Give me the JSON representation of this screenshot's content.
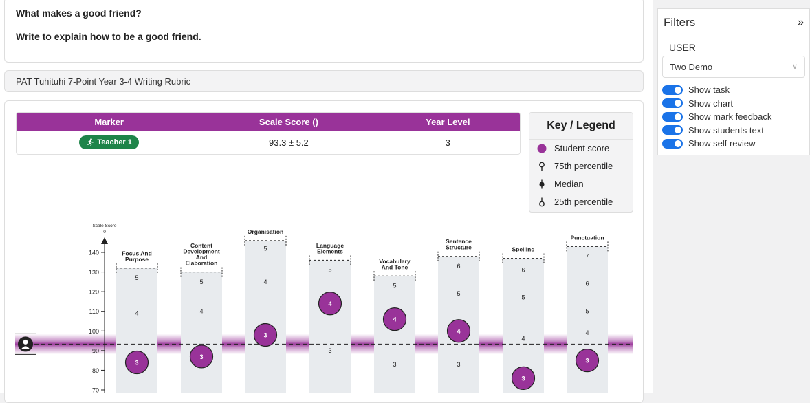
{
  "task": {
    "question": "What makes a good friend?",
    "prompt": "Write to explain how to be a good friend."
  },
  "rubric": {
    "title": "PAT Tuhituhi 7-Point Year 3-4 Writing Rubric"
  },
  "marker_table": {
    "headers": [
      "Marker",
      "Scale Score ()",
      "Year Level"
    ],
    "row": {
      "marker": "Teacher 1",
      "scale_score": "93.3 ± 5.2",
      "year_level": "3"
    }
  },
  "legend": {
    "title": "Key / Legend",
    "items": [
      "Student score",
      "75th percentile",
      "Median",
      "25th percentile"
    ]
  },
  "sidebar": {
    "title": "Filters",
    "user_label": "USER",
    "user_value": "Two Demo",
    "toggles": [
      {
        "label": "Show task",
        "on": true
      },
      {
        "label": "Show chart",
        "on": true
      },
      {
        "label": "Show mark feedback",
        "on": true
      },
      {
        "label": "Show students text",
        "on": true
      },
      {
        "label": "Show self review",
        "on": true
      }
    ]
  },
  "chart_data": {
    "type": "scatter",
    "ylabel": "Scale Score",
    "ylabel_value": "0",
    "yticks": [
      70,
      80,
      90,
      100,
      110,
      120,
      130,
      140
    ],
    "ylim": [
      67,
      152
    ],
    "student_band": 93.3,
    "student_band_error": 5.2,
    "student_score_color": "#993399",
    "categories": [
      {
        "name": "Focus And Purpose",
        "lines": [
          "Focus And",
          "Purpose"
        ],
        "top": 132,
        "levels": [
          {
            "label": "5",
            "y": 127
          },
          {
            "label": "4",
            "y": 109
          }
        ],
        "student": {
          "label": "3",
          "y": 84
        }
      },
      {
        "name": "Content Development And Elaboration",
        "lines": [
          "Content",
          "Development",
          "And",
          "Elaboration"
        ],
        "top": 130,
        "levels": [
          {
            "label": "5",
            "y": 125
          },
          {
            "label": "4",
            "y": 110
          }
        ],
        "student": {
          "label": "3",
          "y": 87
        }
      },
      {
        "name": "Organisation",
        "lines": [
          "Organisation"
        ],
        "top": 146,
        "levels": [
          {
            "label": "5",
            "y": 142
          },
          {
            "label": "4",
            "y": 125
          }
        ],
        "student": {
          "label": "3",
          "y": 98
        }
      },
      {
        "name": "Language Elements",
        "lines": [
          "Language",
          "Elements"
        ],
        "top": 136,
        "levels": [
          {
            "label": "5",
            "y": 131
          },
          {
            "label": "3",
            "y": 90
          }
        ],
        "student": {
          "label": "4",
          "y": 114
        }
      },
      {
        "name": "Vocabulary And Tone",
        "lines": [
          "Vocabulary",
          "And Tone"
        ],
        "top": 128,
        "levels": [
          {
            "label": "5",
            "y": 123
          },
          {
            "label": "3",
            "y": 83
          }
        ],
        "student": {
          "label": "4",
          "y": 106
        }
      },
      {
        "name": "Sentence Structure",
        "lines": [
          "Sentence",
          "Structure"
        ],
        "top": 138,
        "levels": [
          {
            "label": "6",
            "y": 133
          },
          {
            "label": "5",
            "y": 119
          },
          {
            "label": "3",
            "y": 83
          }
        ],
        "student": {
          "label": "4",
          "y": 100
        }
      },
      {
        "name": "Spelling",
        "lines": [
          "Spelling"
        ],
        "top": 137,
        "levels": [
          {
            "label": "6",
            "y": 131
          },
          {
            "label": "5",
            "y": 117
          },
          {
            "label": "4",
            "y": 96
          }
        ],
        "student": {
          "label": "3",
          "y": 76
        }
      },
      {
        "name": "Punctuation",
        "lines": [
          "Punctuation"
        ],
        "top": 143,
        "levels": [
          {
            "label": "7",
            "y": 138
          },
          {
            "label": "6",
            "y": 124
          },
          {
            "label": "5",
            "y": 110
          },
          {
            "label": "4",
            "y": 99
          }
        ],
        "student": {
          "label": "3",
          "y": 85
        }
      }
    ]
  }
}
